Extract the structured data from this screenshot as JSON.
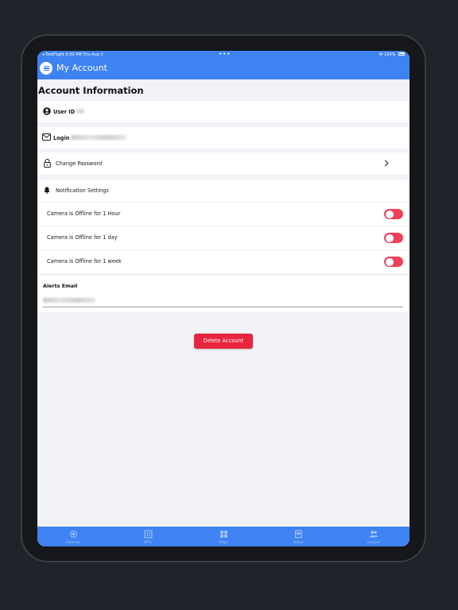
{
  "status_bar": {
    "left": "◂ TestFlight  6:50 PM  Thu Aug 3",
    "center": "•••",
    "right": "100%"
  },
  "header": {
    "title": "My Account"
  },
  "account": {
    "section_title": "Account Information",
    "user_id_label": "User ID",
    "login_label": "Login",
    "change_password_label": "Change Password",
    "notification_settings_label": "Notification Settings"
  },
  "notifications": [
    {
      "label": "Camera is Offline for 1 Hour",
      "enabled": true
    },
    {
      "label": "Camera is Offline for 1 day",
      "enabled": true
    },
    {
      "label": "Camera is Offline for 1 week",
      "enabled": true
    }
  ],
  "alerts_email": {
    "label": "Alerts Email"
  },
  "delete_button": {
    "label": "Delete Account"
  },
  "tabs": [
    {
      "label": "Cameras",
      "icon": "camera-icon"
    },
    {
      "label": "NFTs",
      "icon": "qr-icon"
    },
    {
      "label": "Views",
      "icon": "grid-icon"
    },
    {
      "label": "Videos",
      "icon": "video-icon"
    },
    {
      "label": "Account",
      "icon": "users-icon"
    }
  ],
  "colors": {
    "primary": "#3f83f2",
    "toggle_on": "#ef4059",
    "danger": "#e8253f",
    "background": "#f2f3f7"
  }
}
